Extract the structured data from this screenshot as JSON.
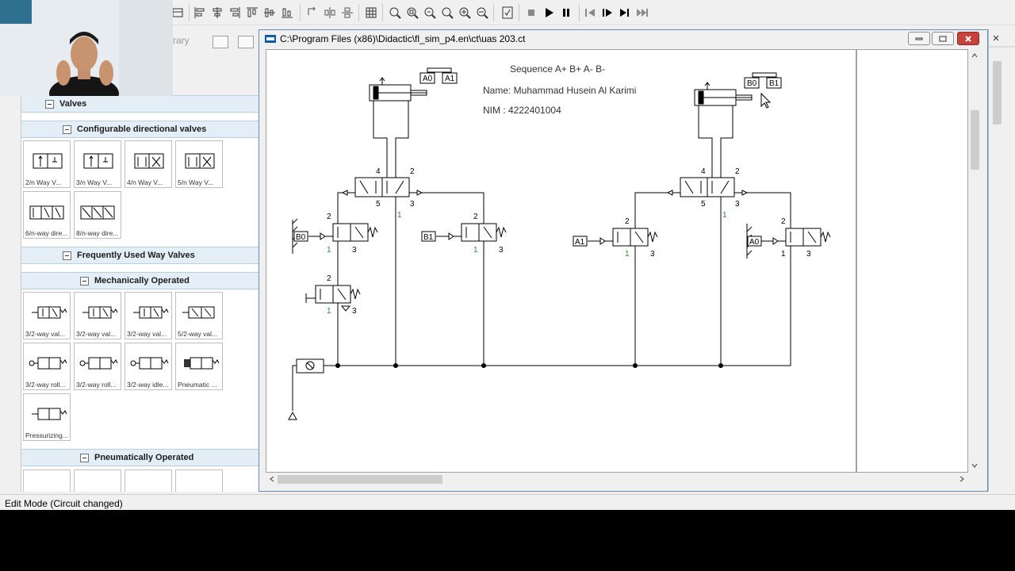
{
  "library": {
    "title": "rary",
    "categories": [
      {
        "label": "Valves"
      },
      {
        "label": "Configurable directional valves"
      },
      {
        "label": "Frequently Used Way Valves"
      },
      {
        "label": "Mechanically Operated"
      },
      {
        "label": "Pneumatically Operated"
      }
    ],
    "config_tiles": [
      "2/n Way V...",
      "3/n Way V...",
      "4/n Way V...",
      "5/n Way V...",
      "6/n-way dire...",
      "8/n-way dire..."
    ],
    "mech_tiles": [
      "3/2-way val...",
      "3/2-way val...",
      "3/2-way val...",
      "5/2-way val...",
      "3/2-way roll...",
      "3/2-way roll...",
      "3/2-way idle...",
      "Pneumatic ...",
      "Pressurizing..."
    ]
  },
  "circuit_window": {
    "title": "C:\\Program Files (x86)\\Didactic\\fl_sim_p4.en\\ct\\uas 203.ct"
  },
  "circuit": {
    "sequence": "Sequence A+ B+ A- B-",
    "name_line": "Name: Muhammad Husein Al Karimi",
    "nim_line": "NIM :  4222401004",
    "sensor_labels": {
      "a0": "A0",
      "a1": "A1",
      "b0": "B0",
      "b1": "B1"
    },
    "port_labels": {
      "p1": "1",
      "p2": "2",
      "p3": "3",
      "p4": "4",
      "p5": "5"
    }
  },
  "status": {
    "text": "Edit Mode (Circuit changed)"
  },
  "colors": {
    "close_button": "#c7423c",
    "category_header": "#e3eef7",
    "port_green": "#2e8b2e"
  }
}
